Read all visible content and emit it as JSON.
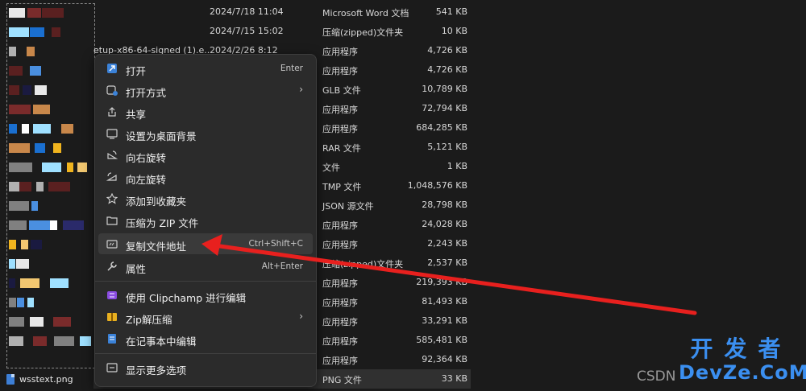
{
  "files": [
    {
      "name": "",
      "date": "2024/7/18 11:04",
      "type": "Microsoft Word 文档",
      "size": "541 KB"
    },
    {
      "name": "",
      "date": "2024/7/15 15:02",
      "type": "压缩(zipped)文件夹",
      "size": "10 KB"
    },
    {
      "name": "etup-x86-64-signed (1).e...",
      "date": "2024/2/26 8:12",
      "type": "应用程序",
      "size": "4,726 KB"
    },
    {
      "name": "",
      "date": "",
      "type": "应用程序",
      "size": "4,726 KB"
    },
    {
      "name": "",
      "date": "",
      "type": "GLB 文件",
      "size": "10,789 KB"
    },
    {
      "name": "",
      "date": "",
      "type": "应用程序",
      "size": "72,794 KB"
    },
    {
      "name": "",
      "date": "",
      "type": "应用程序",
      "size": "684,285 KB"
    },
    {
      "name": "",
      "date": "",
      "type": "RAR 文件",
      "size": "5,121 KB"
    },
    {
      "name": "",
      "date": "",
      "type": "文件",
      "size": "1 KB"
    },
    {
      "name": "",
      "date": "",
      "type": "TMP 文件",
      "size": "1,048,576 KB"
    },
    {
      "name": "",
      "date": "",
      "type": "JSON 源文件",
      "size": "28,798 KB"
    },
    {
      "name": "",
      "date": "",
      "type": "应用程序",
      "size": "24,028 KB"
    },
    {
      "name": "",
      "date": "",
      "type": "应用程序",
      "size": "2,243 KB"
    },
    {
      "name": "",
      "date": "",
      "type": "压缩(zipped)文件夹",
      "size": "2,537 KB"
    },
    {
      "name": "",
      "date": "",
      "type": "应用程序",
      "size": "219,393 KB"
    },
    {
      "name": "",
      "date": "",
      "type": "应用程序",
      "size": "81,493 KB"
    },
    {
      "name": "",
      "date": "",
      "type": "应用程序",
      "size": "33,291 KB"
    },
    {
      "name": "",
      "date": "",
      "type": "应用程序",
      "size": "585,481 KB"
    },
    {
      "name": "",
      "date": "",
      "type": "应用程序",
      "size": "92,364 KB"
    },
    {
      "name": "",
      "date": "",
      "type": "PNG 文件",
      "size": "33 KB"
    }
  ],
  "selected_file": {
    "name": "wsstext.png"
  },
  "context_menu": {
    "items": [
      {
        "label": "打开",
        "shortcut": "Enter",
        "icon": "open-icon"
      },
      {
        "label": "打开方式",
        "icon": "open-with-icon",
        "submenu": "›"
      },
      {
        "label": "共享",
        "icon": "share-icon"
      },
      {
        "label": "设置为桌面背景",
        "icon": "wallpaper-icon"
      },
      {
        "label": "向右旋转",
        "icon": "rotate-right-icon"
      },
      {
        "label": "向左旋转",
        "icon": "rotate-left-icon"
      },
      {
        "label": "添加到收藏夹",
        "icon": "star-icon"
      },
      {
        "label": "压缩为 ZIP 文件",
        "icon": "zip-folder-icon"
      },
      {
        "label": "复制文件地址",
        "shortcut": "Ctrl+Shift+C",
        "icon": "copy-path-icon"
      },
      {
        "label": "属性",
        "shortcut": "Alt+Enter",
        "icon": "wrench-icon"
      },
      {
        "label": "使用 Clipchamp 进行编辑",
        "icon": "clipchamp-icon"
      },
      {
        "label": "Zip解压缩",
        "icon": "zip-extract-icon",
        "submenu": "›"
      },
      {
        "label": "在记事本中编辑",
        "icon": "notepad-icon"
      },
      {
        "label": "显示更多选项",
        "icon": "more-options-icon"
      }
    ]
  },
  "watermark": {
    "csdn": "CSDN",
    "logo_top": "开发者",
    "logo_bottom": "DevZe.CoM"
  },
  "colors": {
    "accent": "#3b8ff0",
    "arrow": "#e8201e"
  }
}
